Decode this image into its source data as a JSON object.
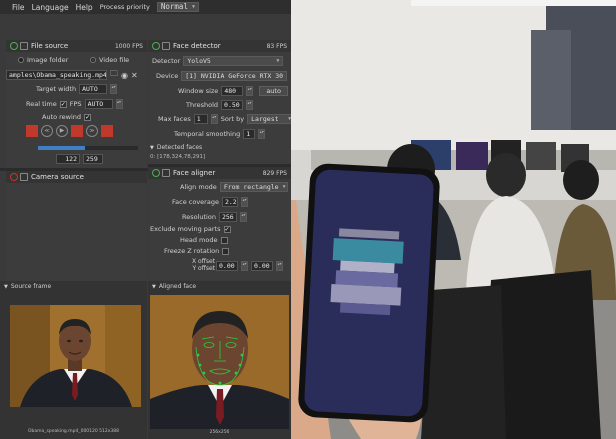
{
  "menu": {
    "items": [
      "File",
      "Language",
      "Help"
    ],
    "process_priority_label": "Process priority",
    "process_priority_value": "Normal"
  },
  "file_source": {
    "title": "File source",
    "fps": "1000 FPS",
    "image_folder_label": "Image folder",
    "video_file_label": "Video file",
    "path": "amples\\Obama_speaking.mp4",
    "target_width_label": "Target width",
    "target_width_value": "AUTO",
    "real_time_label": "Real time",
    "fps_label": "FPS",
    "fps_value": "AUTO",
    "auto_rewind_label": "Auto rewind",
    "frame_current": "122",
    "frame_total": "259",
    "progress": 0.47
  },
  "camera_source": {
    "title": "Camera source"
  },
  "face_detector": {
    "title": "Face detector",
    "fps": "83 FPS",
    "detector_label": "Detector",
    "detector_value": "YoloV5",
    "device_label": "Device",
    "device_value": "[1] NVIDIA GeForce RTX 30",
    "window_size_label": "Window size",
    "window_size_value": "480",
    "auto_label": "auto",
    "threshold_label": "Threshold",
    "threshold_value": "0.50",
    "max_faces_label": "Max faces",
    "max_faces_value": "1",
    "sort_by_label": "Sort by",
    "sort_by_value": "Largest",
    "temporal_label": "Temporal smoothing",
    "temporal_value": "1",
    "detected_faces_label": "Detected faces",
    "detected_faces_value": "0: [178,324,78,291]"
  },
  "face_aligner": {
    "title": "Face aligner",
    "fps": "829 FPS",
    "align_mode_label": "Align mode",
    "align_mode_value": "From rectangle",
    "face_coverage_label": "Face coverage",
    "face_coverage_value": "2.2",
    "resolution_label": "Resolution",
    "resolution_value": "256",
    "exclude_label": "Exclude moving parts",
    "head_mode_label": "Head mode",
    "freeze_z_label": "Freeze Z rotation",
    "x_offset_label": "X offset",
    "y_offset_label": "Y offset",
    "x_offset_value": "0.00",
    "y_offset_value": "0.00"
  },
  "source_frame": {
    "title": "Source frame",
    "caption": "Obama_speaking.mp4_000120 512x388"
  },
  "aligned_face": {
    "title": "Aligned face",
    "caption": "256x256"
  },
  "colors": {
    "panel": "#3c3c3c",
    "title_bar": "#343434",
    "power_on": "#4caf50",
    "record_red": "#c0392b",
    "progress_blue": "#3f7fc4",
    "landmark_green": "#2ecc40"
  }
}
